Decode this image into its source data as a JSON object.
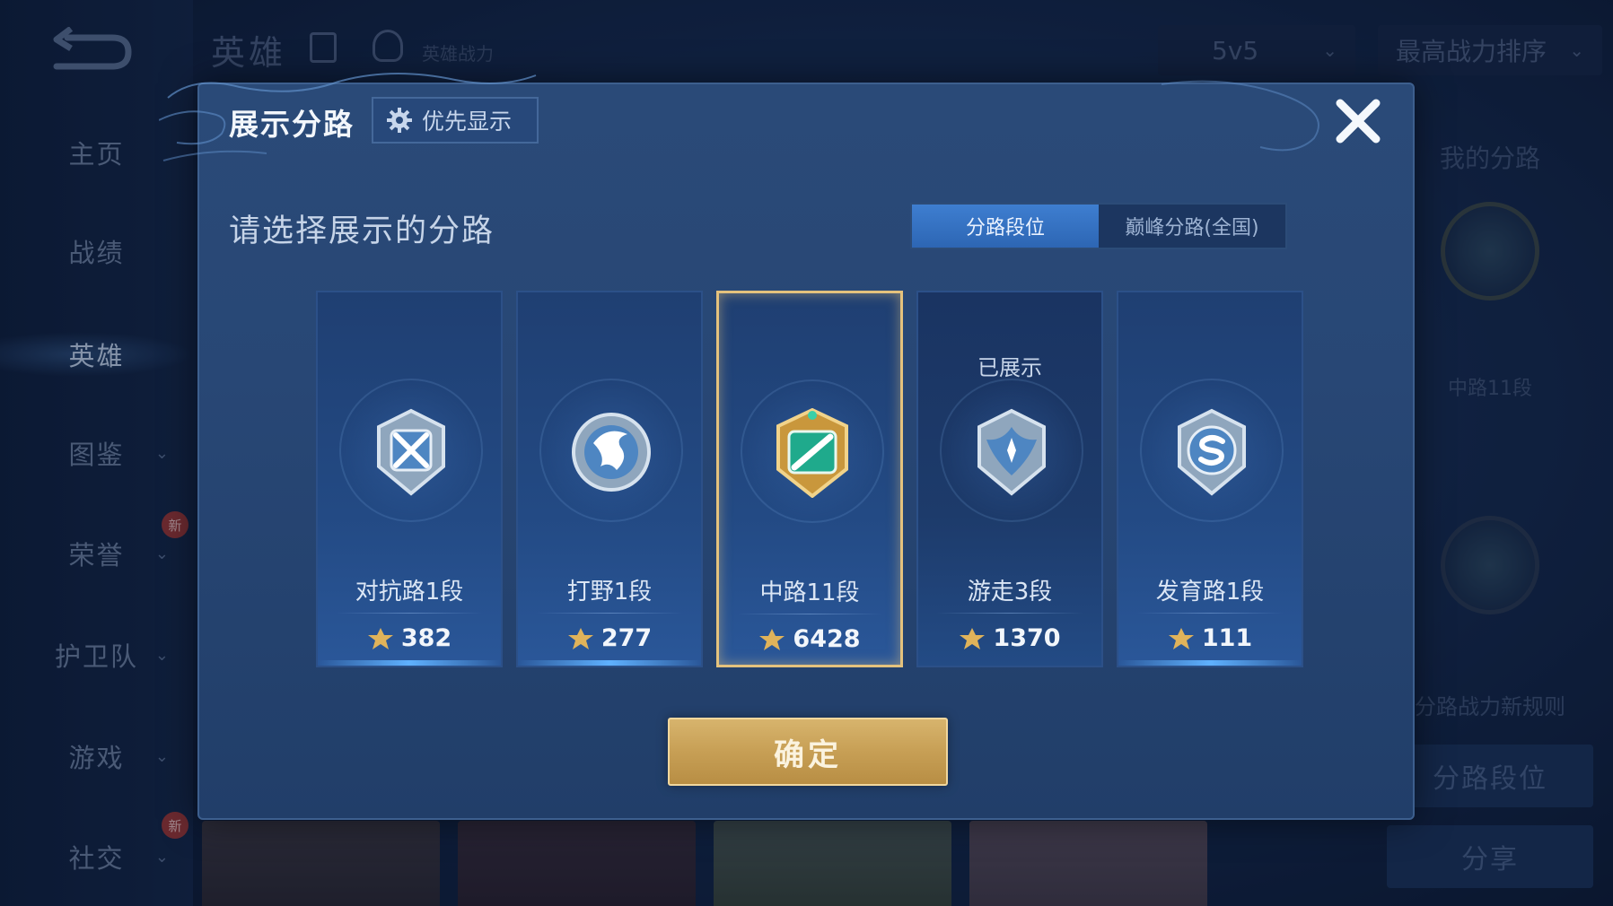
{
  "background": {
    "sidebar": {
      "items": [
        {
          "label": "主页",
          "chevron": false,
          "badge": ""
        },
        {
          "label": "战绩",
          "chevron": false,
          "badge": ""
        },
        {
          "label": "英雄",
          "chevron": false,
          "badge": "",
          "active": true
        },
        {
          "label": "图鉴",
          "chevron": true,
          "badge": ""
        },
        {
          "label": "荣誉",
          "chevron": true,
          "badge": "新"
        },
        {
          "label": "护卫队",
          "chevron": true,
          "badge": ""
        },
        {
          "label": "游戏",
          "chevron": true,
          "badge": ""
        },
        {
          "label": "社交",
          "chevron": true,
          "badge": "新"
        }
      ]
    },
    "header": {
      "title": "英雄",
      "subtitle": "英雄战力",
      "mode_select": "5v5",
      "sort_select": "最高战力排序"
    },
    "right_panel": {
      "title": "我的分路",
      "lane_rank": "中路11段",
      "rules_link": "分路战力新规则",
      "lane_button": "分路段位",
      "share_button": "分享"
    }
  },
  "modal": {
    "title": "展示分路",
    "priority_button": "优先显示",
    "subheading": "请选择展示的分路",
    "tabs": [
      {
        "label": "分路段位",
        "active": true
      },
      {
        "label": "巅峰分路(全国)",
        "active": false
      }
    ],
    "lanes": [
      {
        "label": "对抗路1段",
        "score": "382",
        "status": "",
        "selected": false,
        "emblem": "clash-lane-emblem-icon"
      },
      {
        "label": "打野1段",
        "score": "277",
        "status": "",
        "selected": false,
        "emblem": "jungle-emblem-icon"
      },
      {
        "label": "中路11段",
        "score": "6428",
        "status": "",
        "selected": true,
        "emblem": "mid-lane-emblem-icon"
      },
      {
        "label": "游走3段",
        "score": "1370",
        "status": "已展示",
        "selected": false,
        "emblem": "roam-emblem-icon"
      },
      {
        "label": "发育路1段",
        "score": "111",
        "status": "",
        "selected": false,
        "emblem": "farm-lane-emblem-icon"
      }
    ],
    "confirm_button": "确定"
  },
  "colors": {
    "selected_border": "#e4c27d",
    "active_tab": "#3e7ed0",
    "confirm_button": "#c79f55"
  }
}
